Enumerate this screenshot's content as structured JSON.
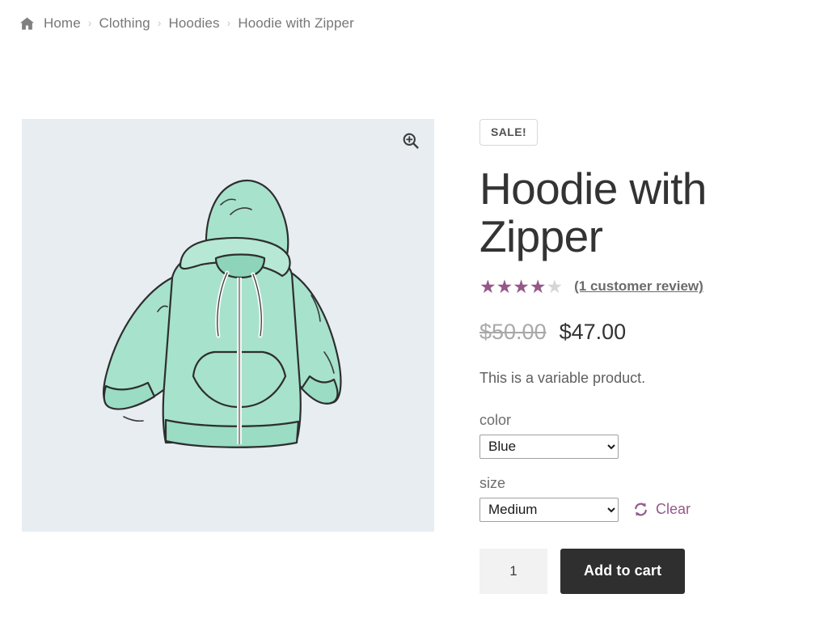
{
  "breadcrumb": {
    "home_icon": "home-icon",
    "separator": "›",
    "items": [
      {
        "label": "Home",
        "current": false
      },
      {
        "label": "Clothing",
        "current": false
      },
      {
        "label": "Hoodies",
        "current": false
      },
      {
        "label": "Hoodie with Zipper",
        "current": true
      }
    ]
  },
  "gallery": {
    "zoom_icon": "zoom-in-icon",
    "image_alt": "Hoodie with Zipper",
    "background_color": "#e7edf1",
    "garment_color": "#a7e2cd",
    "outline_color": "#2e2e2e"
  },
  "product": {
    "sale_badge": "SALE!",
    "title": "Hoodie with Zipper",
    "rating": {
      "value": 4,
      "max": 5,
      "star_color": "#96588a",
      "empty_star_color": "#d6d6d6",
      "review_link": "(1 customer review)"
    },
    "price": {
      "original": "$50.00",
      "sale": "$47.00"
    },
    "short_description": "This is a variable product."
  },
  "variations": [
    {
      "name": "color",
      "label": "color",
      "selected": "Blue",
      "options": [
        "Blue"
      ]
    },
    {
      "name": "size",
      "label": "size",
      "selected": "Medium",
      "options": [
        "Medium"
      ]
    }
  ],
  "clear": {
    "label": "Clear",
    "icon": "refresh-icon",
    "color": "#96588a"
  },
  "cart": {
    "quantity": "1",
    "quantity_placeholder": "1",
    "add_to_cart_label": "Add to cart",
    "button_color": "#2f2f2f"
  }
}
